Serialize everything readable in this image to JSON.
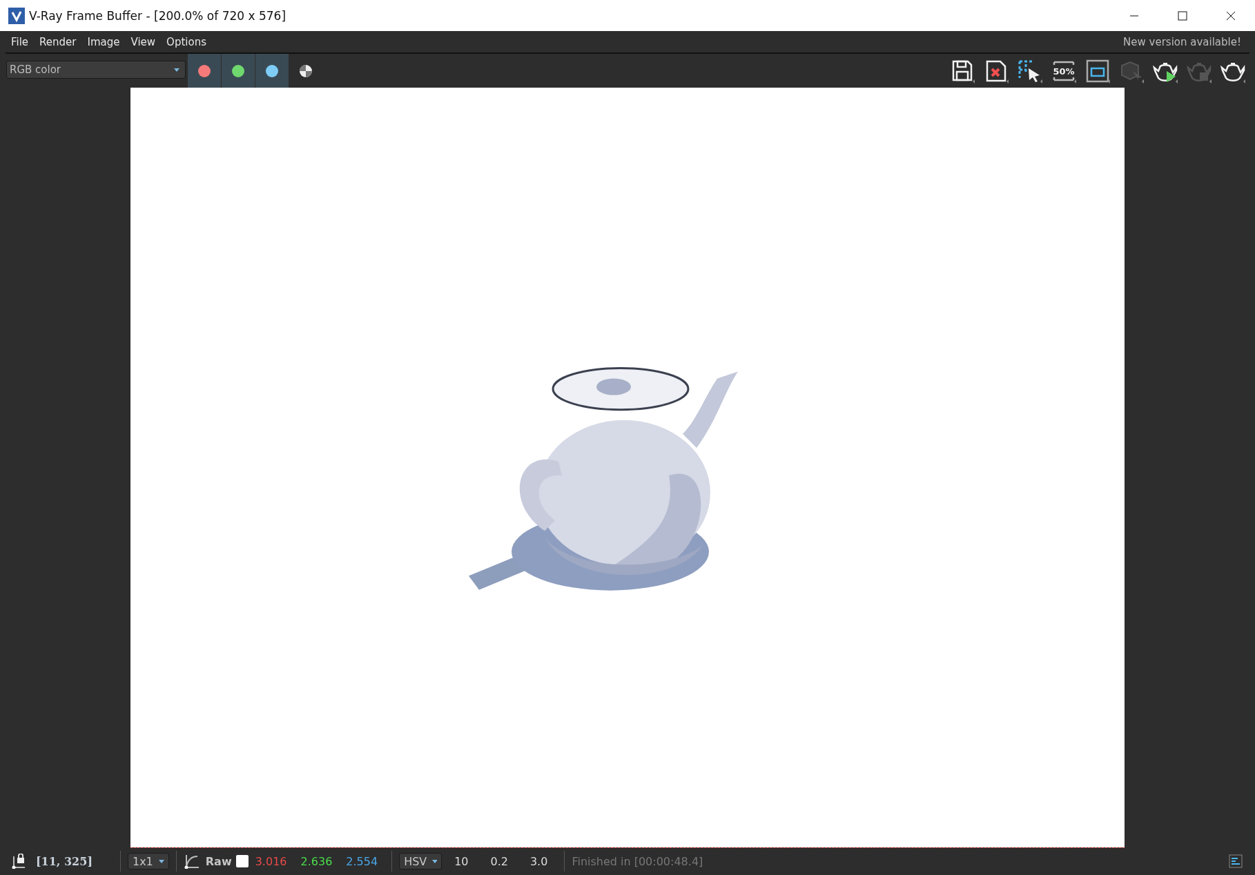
{
  "window": {
    "title": "V-Ray Frame Buffer - [200.0% of 720 x 576]"
  },
  "menu": [
    "File",
    "Render",
    "Image",
    "View",
    "Options"
  ],
  "notice": "New version available!",
  "channel_select": {
    "value": "RGB color"
  },
  "channels": [
    {
      "kind": "color",
      "color": "#f77a7a",
      "selected": true
    },
    {
      "kind": "color",
      "color": "#6fd86f",
      "selected": true
    },
    {
      "kind": "color",
      "color": "#7dcdf7",
      "selected": true
    },
    {
      "kind": "alpha",
      "selected": false
    }
  ],
  "toolbar": [
    {
      "kind": "save",
      "disabled": false
    },
    {
      "kind": "clear",
      "disabled": false
    },
    {
      "kind": "region",
      "disabled": false
    },
    {
      "kind": "zoom",
      "label": "50%",
      "disabled": false
    },
    {
      "kind": "frame",
      "disabled": false
    },
    {
      "kind": "region_render",
      "disabled": true
    },
    {
      "kind": "interactive",
      "disabled": false
    },
    {
      "kind": "stop",
      "disabled": true
    },
    {
      "kind": "render",
      "disabled": false
    }
  ],
  "status_bar": {
    "coordinates": "[11, 325]",
    "sample_size": "1x1",
    "mode": "Raw",
    "values": [
      {
        "text": "3.016",
        "color": "#e84a4a"
      },
      {
        "text": "2.636",
        "color": "#4ade4a"
      },
      {
        "text": "2.554",
        "color": "#4aa8e8"
      }
    ],
    "color_space": "HSV",
    "readouts": [
      "10",
      "0.2",
      "3.0"
    ],
    "message": "Finished in [00:00:48.4]"
  }
}
